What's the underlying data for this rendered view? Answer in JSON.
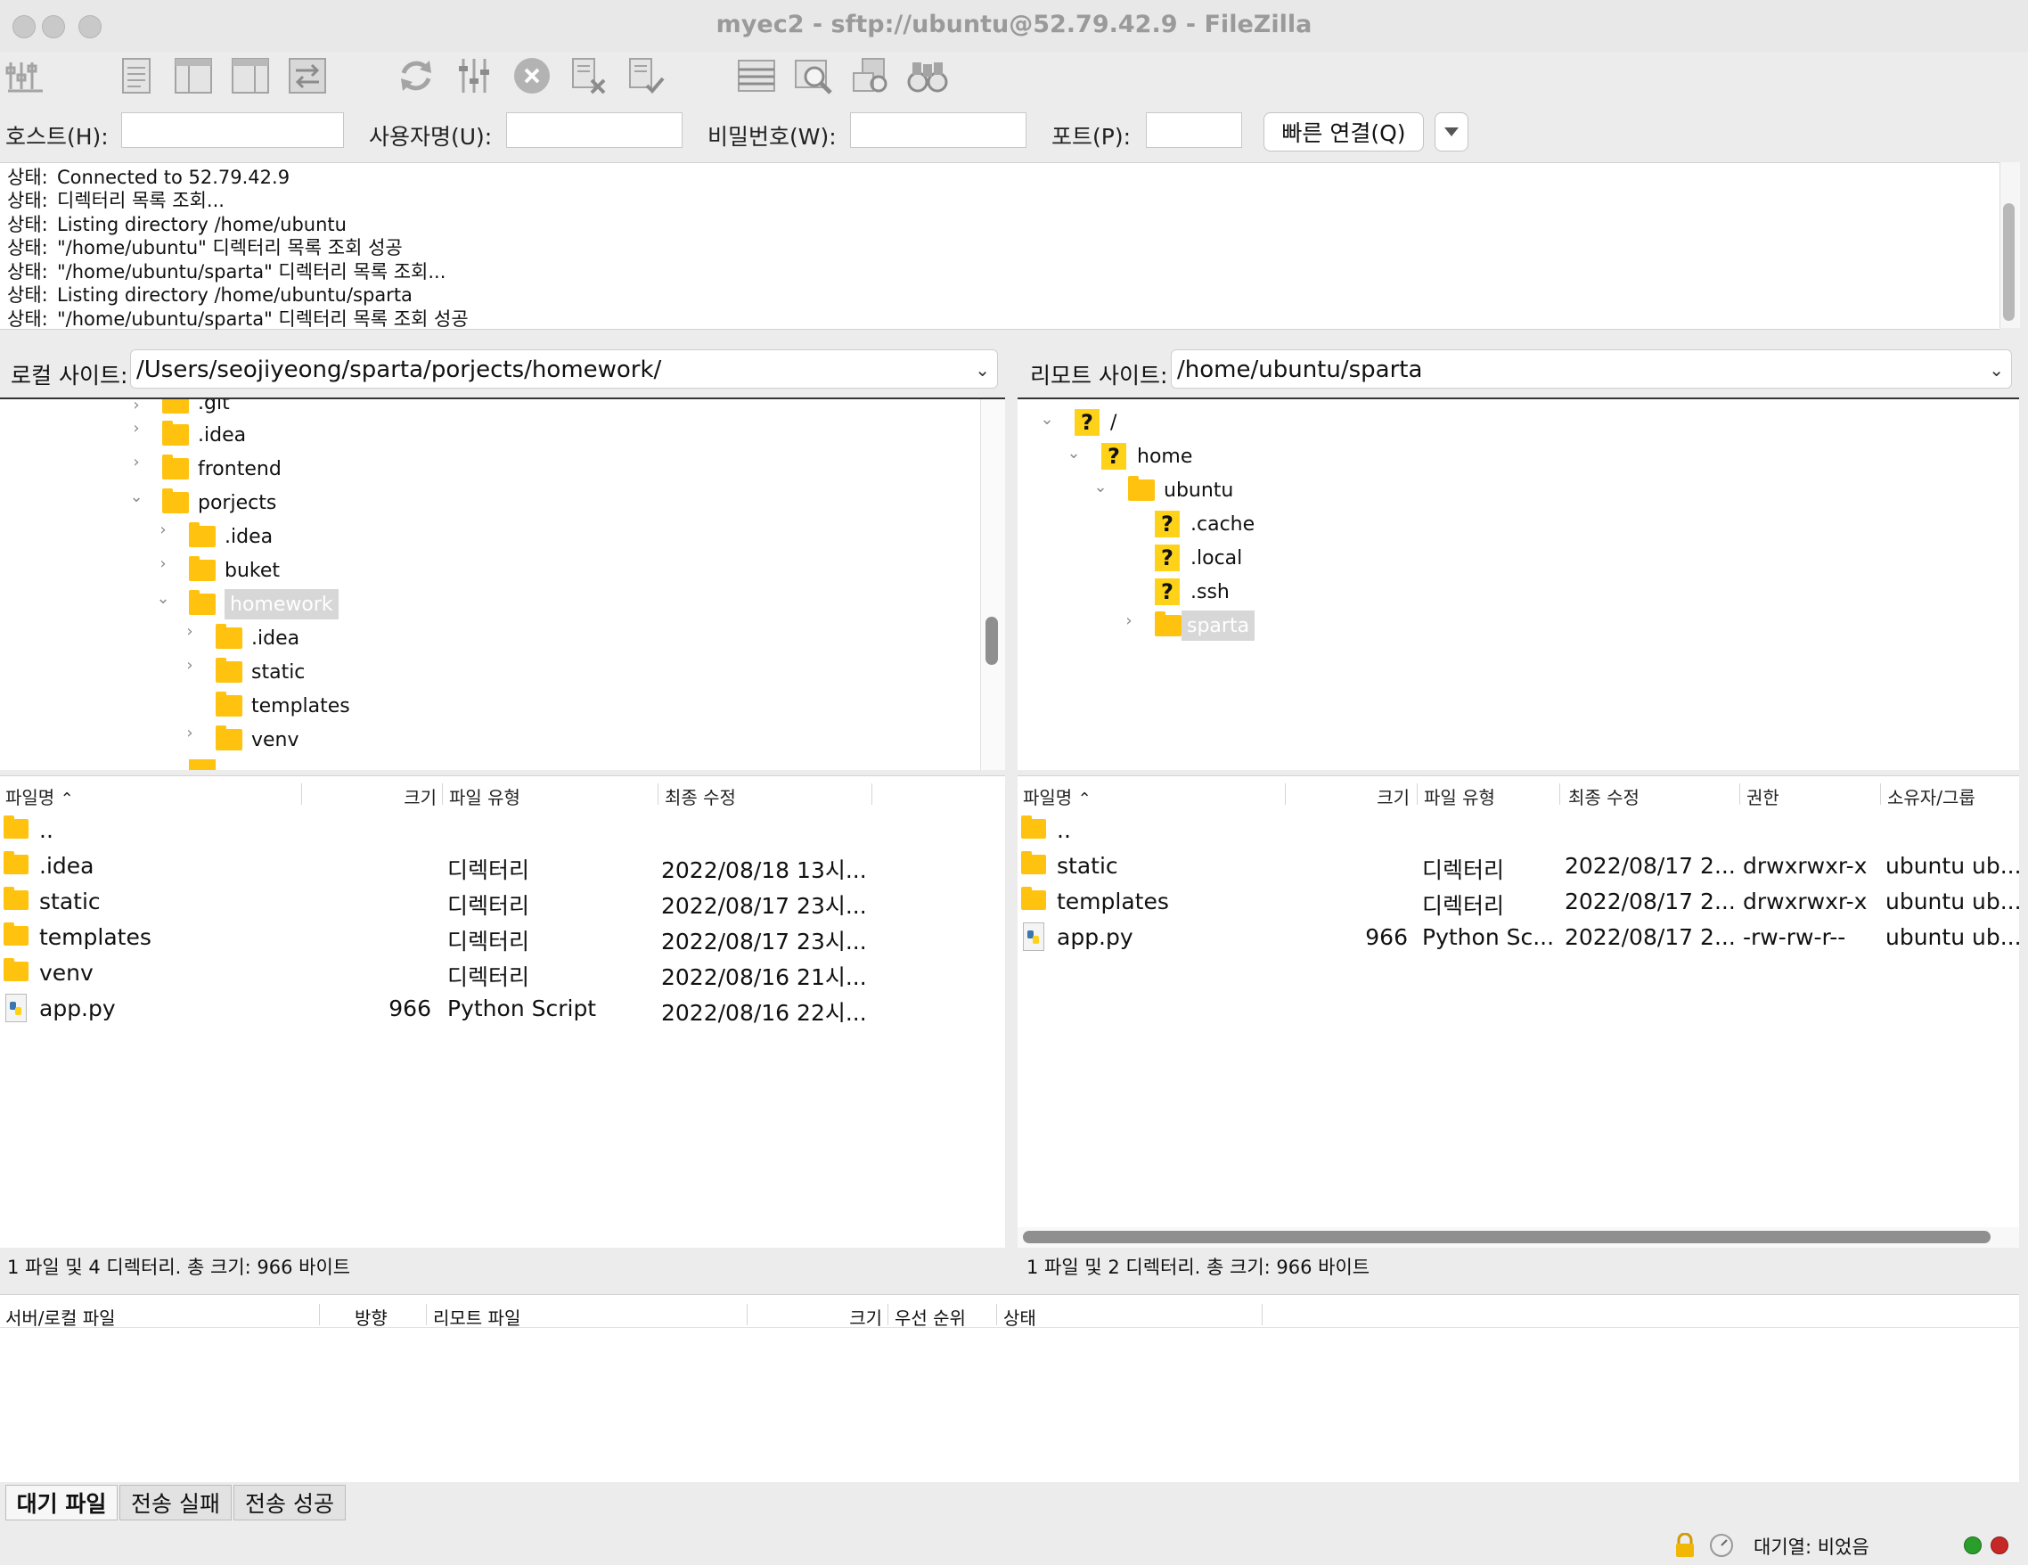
{
  "window": {
    "title": "myec2 - sftp://ubuntu@52.79.42.9 - FileZilla"
  },
  "toolbar": {
    "icons": [
      "site-manager-icon",
      "log-toggle-icon",
      "local-tree-toggle-icon",
      "remote-tree-toggle-icon",
      "transfer-queue-toggle-icon",
      "refresh-icon",
      "filter-icon",
      "cancel-icon",
      "disconnect-icon",
      "reconnect-icon",
      "compare-icon",
      "search-icon",
      "sync-browse-icon",
      "find-icon"
    ]
  },
  "quickconnect": {
    "host_label": "호스트(H):",
    "user_label": "사용자명(U):",
    "pass_label": "비밀번호(W):",
    "port_label": "포트(P):",
    "host_value": "",
    "user_value": "",
    "pass_value": "",
    "port_value": "",
    "connect_label": "빠른 연결(Q)"
  },
  "log": {
    "lines": [
      {
        "label": "상태:",
        "text": "Connected to 52.79.42.9"
      },
      {
        "label": "상태:",
        "text": "디렉터리 목록 조회..."
      },
      {
        "label": "상태:",
        "text": "Listing directory /home/ubuntu"
      },
      {
        "label": "상태:",
        "text": "\"/home/ubuntu\" 디렉터리 목록 조회 성공"
      },
      {
        "label": "상태:",
        "text": "\"/home/ubuntu/sparta\" 디렉터리 목록 조회..."
      },
      {
        "label": "상태:",
        "text": "Listing directory /home/ubuntu/sparta"
      },
      {
        "label": "상태:",
        "text": "\"/home/ubuntu/sparta\" 디렉터리 목록 조회 성공"
      }
    ]
  },
  "local": {
    "site_label": "로컬 사이트:",
    "path": "/Users/seojiyeong/sparta/porjects/homework/",
    "tree": [
      ".git",
      ".idea",
      "frontend",
      "porjects",
      ".idea",
      "buket",
      "homework",
      ".idea",
      "static",
      "templates",
      "venv"
    ],
    "columns": {
      "name": "파일명",
      "size": "크기",
      "type": "파일 유형",
      "modified": "최종 수정"
    },
    "files": [
      {
        "name": "..",
        "size": "",
        "type": "",
        "modified": ""
      },
      {
        "name": ".idea",
        "size": "",
        "type": "디렉터리",
        "modified": "2022/08/18 13시..."
      },
      {
        "name": "static",
        "size": "",
        "type": "디렉터리",
        "modified": "2022/08/17 23시..."
      },
      {
        "name": "templates",
        "size": "",
        "type": "디렉터리",
        "modified": "2022/08/17 23시..."
      },
      {
        "name": "venv",
        "size": "",
        "type": "디렉터리",
        "modified": "2022/08/16 21시..."
      },
      {
        "name": "app.py",
        "size": "966",
        "type": "Python Script",
        "modified": "2022/08/16 22시..."
      }
    ],
    "status": "1 파일 및 4 디렉터리. 총 크기: 966 바이트"
  },
  "remote": {
    "site_label": "리모트 사이트:",
    "path": "/home/ubuntu/sparta",
    "tree": [
      "/",
      "home",
      "ubuntu",
      ".cache",
      ".local",
      ".ssh",
      "sparta"
    ],
    "columns": {
      "name": "파일명",
      "size": "크기",
      "type": "파일 유형",
      "modified": "최종 수정",
      "perms": "권한",
      "owner": "소유자/그룹"
    },
    "files": [
      {
        "name": "..",
        "size": "",
        "type": "",
        "modified": "",
        "perms": "",
        "owner": ""
      },
      {
        "name": "static",
        "size": "",
        "type": "디렉터리",
        "modified": "2022/08/17 2...",
        "perms": "drwxrwxr-x",
        "owner": "ubuntu ub..."
      },
      {
        "name": "templates",
        "size": "",
        "type": "디렉터리",
        "modified": "2022/08/17 2...",
        "perms": "drwxrwxr-x",
        "owner": "ubuntu ub..."
      },
      {
        "name": "app.py",
        "size": "966",
        "type": "Python Sc...",
        "modified": "2022/08/17 2...",
        "perms": "-rw-rw-r--",
        "owner": "ubuntu ub..."
      }
    ],
    "status": "1 파일 및 2 디렉터리. 총 크기: 966 바이트"
  },
  "queue": {
    "columns": {
      "server_local": "서버/로컬 파일",
      "direction": "방향",
      "remote_file": "리모트 파일",
      "size": "크기",
      "priority": "우선 순위",
      "status": "상태"
    },
    "tabs": [
      "대기 파일",
      "전송 실패",
      "전송 성공"
    ]
  },
  "statusbar": {
    "queue_text": "대기열: 비었음"
  },
  "colors": {
    "folder": "#ffc20e",
    "accent": "#ffd21a"
  }
}
